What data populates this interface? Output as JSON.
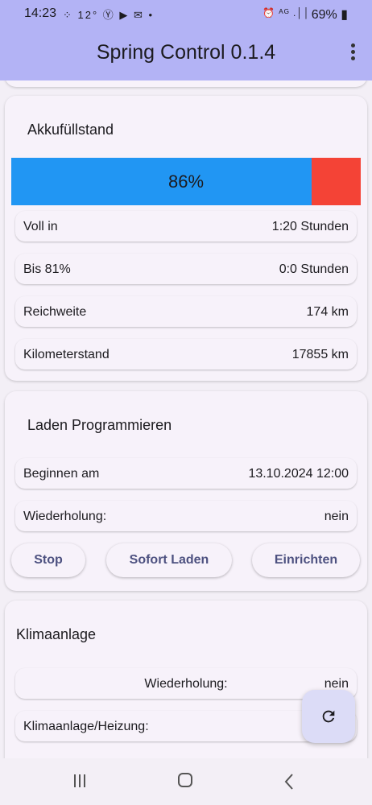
{
  "status_bar": {
    "time": "14:23",
    "left_icons": "⁘ 12° Ⓨ ▶ ✉ •",
    "right_icons": "⏰ ᴬᴳ .││",
    "battery": "69%"
  },
  "app_bar": {
    "title": "Spring Control 0.1.4"
  },
  "battery_card": {
    "title": "Akkufüllstand",
    "level_percent": 86,
    "level_label": "86%",
    "colors": {
      "fill": "#2196f3",
      "remaining": "#f44336"
    },
    "rows": [
      {
        "label": "Voll in",
        "value": "1:20 Stunden"
      },
      {
        "label": "Bis 81%",
        "value": "0:0 Stunden"
      },
      {
        "label": "Reichweite",
        "value": "174 km"
      },
      {
        "label": "Kilometerstand",
        "value": "17855 km"
      }
    ]
  },
  "charge_card": {
    "title": "Laden Programmieren",
    "rows": [
      {
        "label": "Beginnen am",
        "value": "13.10.2024 12:00"
      },
      {
        "label": "Wiederholung:",
        "value": "nein"
      }
    ],
    "buttons": {
      "stop": "Stop",
      "instant": "Sofort Laden",
      "setup": "Einrichten"
    }
  },
  "climate_card": {
    "title": "Klimaanlage",
    "rows": [
      {
        "label": "Wiederholung:",
        "value": "nein"
      },
      {
        "label": "Klimaanlage/Heizung:",
        "value": ""
      }
    ]
  },
  "fab": {
    "icon": "refresh-icon"
  },
  "nav_bar": {
    "icons": [
      "recents-icon",
      "home-icon",
      "back-icon"
    ]
  }
}
